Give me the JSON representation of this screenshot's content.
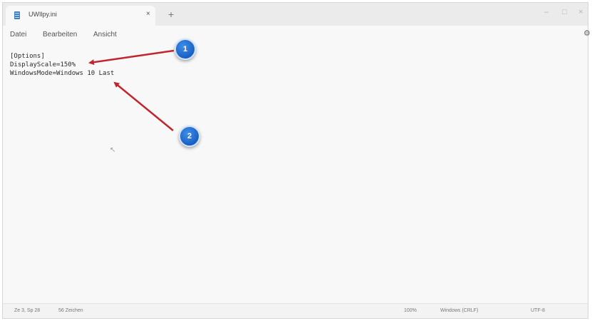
{
  "tab": {
    "title": "UWIlpy.ini",
    "close_label": "×"
  },
  "newtab_label": "+",
  "window_controls": {
    "minimize": "–",
    "maximize": "□",
    "close": "×"
  },
  "menu": {
    "file": "Datei",
    "edit": "Bearbeiten",
    "view": "Ansicht"
  },
  "settings_icon": "gear-icon",
  "editor": {
    "lines": [
      "[Options]",
      "DisplayScale=150%",
      "WindowsMode=Windows 10 Last"
    ]
  },
  "annotations": {
    "badge1": "1",
    "badge2": "2",
    "arrow_color": "#c0262e",
    "badge_color": "#1f6fd6"
  },
  "status": {
    "position": "Ze 3, Sp 28",
    "chars": "56 Zeichen",
    "zoom": "100%",
    "line_ending": "Windows (CRLF)",
    "encoding": "UTF-8"
  }
}
